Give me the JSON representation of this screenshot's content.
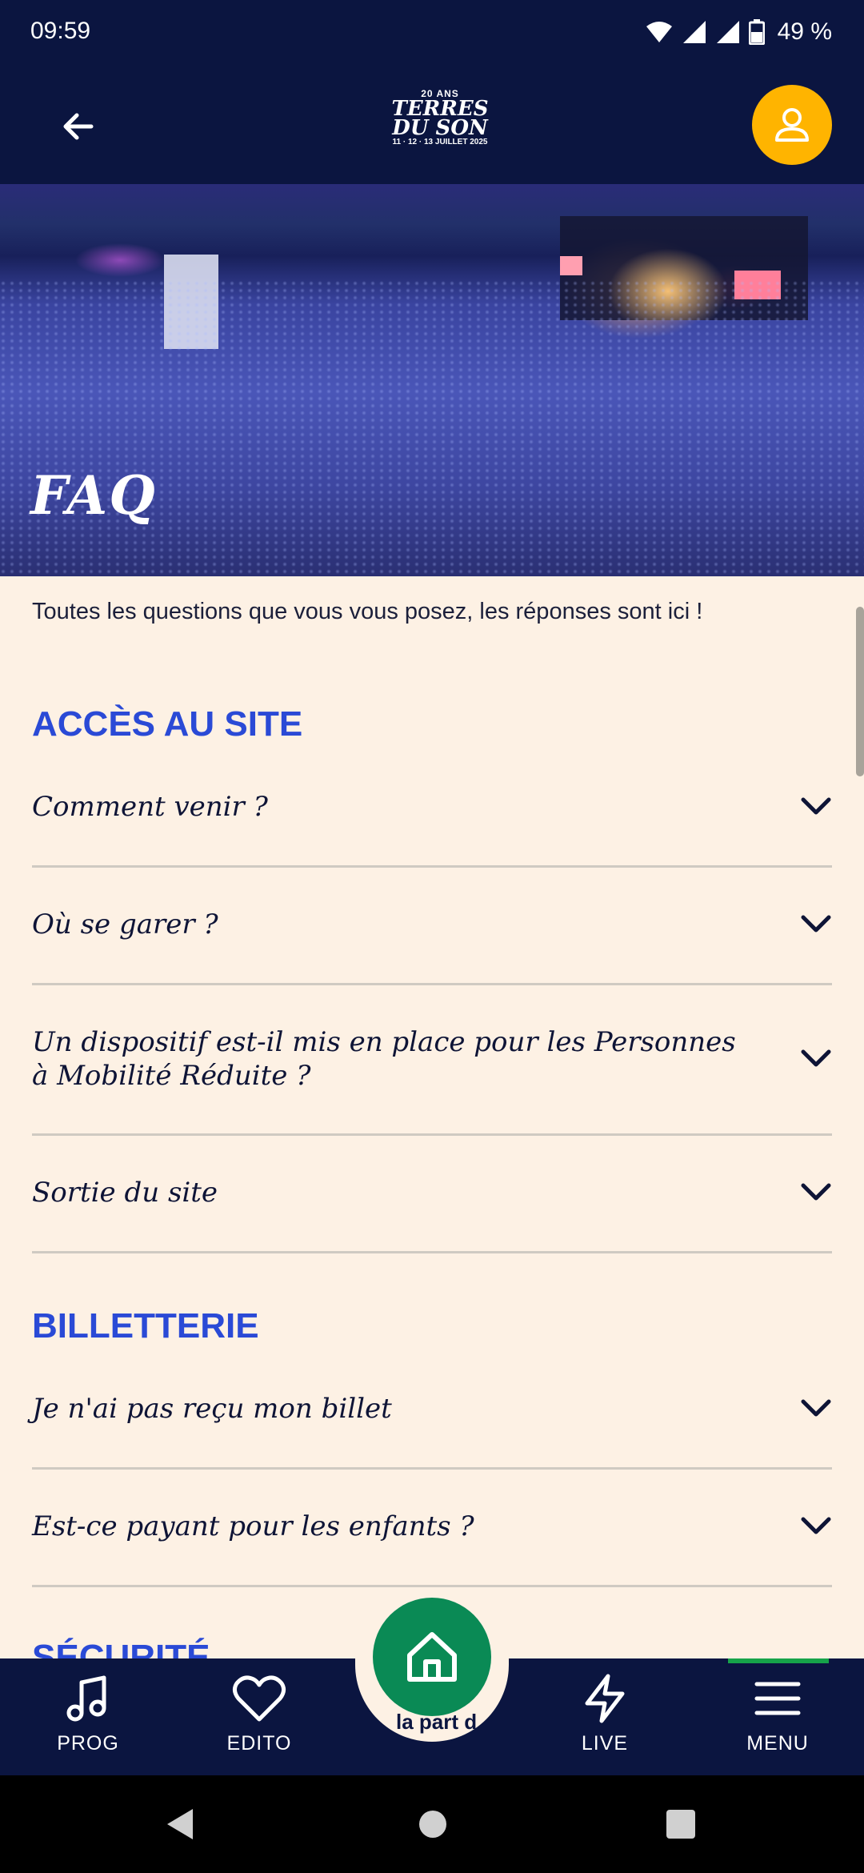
{
  "status_bar": {
    "time": "09:59",
    "battery": "49 %"
  },
  "header": {
    "logo": {
      "small": "20 ANS",
      "line1": "TERRES",
      "line2": "DU SON",
      "dates": "11 · 12 · 13 JUILLET 2025"
    },
    "back_icon": "arrow-left-icon",
    "profile_icon": "user-icon",
    "accent": "#ffb400"
  },
  "hero": {
    "title": "FAQ"
  },
  "intro": "Toutes les questions que vous vous posez, les réponses sont ici !",
  "sections": [
    {
      "title": "ACCÈS AU SITE",
      "items": [
        "Comment venir ?",
        "Où se garer ?",
        "Un dispositif est-il mis en place pour les Personnes à Mobilité Réduite ?",
        "Sortie du site"
      ]
    },
    {
      "title": "BILLETTERIE",
      "items": [
        "Je n'ai pas reçu mon billet",
        "Est-ce payant pour les enfants ?"
      ]
    },
    {
      "title": "SÉCURITÉ",
      "items": []
    }
  ],
  "bottom_nav": {
    "items": [
      {
        "label": "PROG",
        "icon": "music-note-icon"
      },
      {
        "label": "EDITO",
        "icon": "heart-icon"
      },
      {
        "label": "LIVE",
        "icon": "lightning-icon"
      },
      {
        "label": "MENU",
        "icon": "menu-icon"
      }
    ],
    "home_icon": "home-icon",
    "marquee": "la part d",
    "colors": {
      "background": "#0b1540",
      "home": "#0a8a55",
      "active": "#16a34a"
    }
  },
  "colors": {
    "page_bg": "#fdf1e4",
    "section_title": "#2a4ad6",
    "text": "#0e1436"
  }
}
